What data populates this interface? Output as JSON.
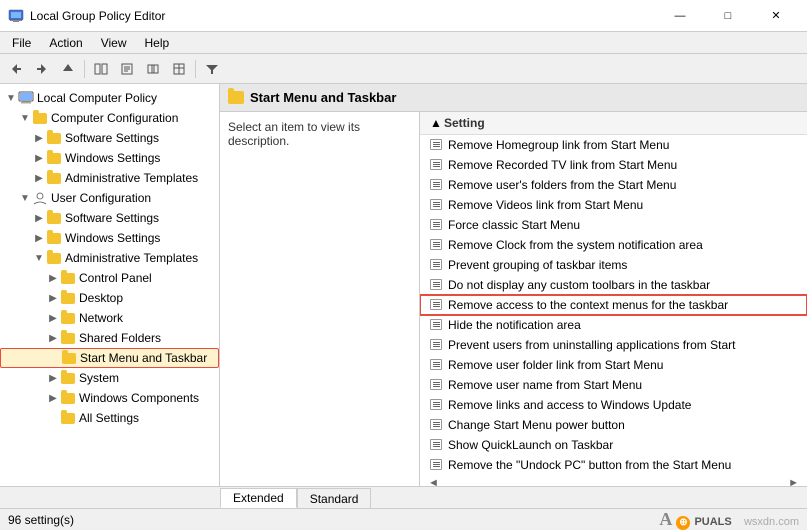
{
  "window": {
    "title": "Local Group Policy Editor",
    "controls": {
      "minimize": "—",
      "maximize": "□",
      "close": "✕"
    }
  },
  "menu": {
    "items": [
      "File",
      "Action",
      "View",
      "Help"
    ]
  },
  "toolbar": {
    "buttons": [
      "◀",
      "▶",
      "⬆",
      "📋",
      "📋",
      "🔗",
      "📋",
      "🔽"
    ]
  },
  "tree": {
    "root_label": "Local Computer Policy",
    "items": [
      {
        "id": "computer-config",
        "label": "Computer Configuration",
        "indent": 1,
        "type": "computer",
        "expanded": true
      },
      {
        "id": "software-settings-1",
        "label": "Software Settings",
        "indent": 2,
        "type": "folder"
      },
      {
        "id": "windows-settings-1",
        "label": "Windows Settings",
        "indent": 2,
        "type": "folder"
      },
      {
        "id": "admin-templates-1",
        "label": "Administrative Templates",
        "indent": 2,
        "type": "folder"
      },
      {
        "id": "user-config",
        "label": "User Configuration",
        "indent": 1,
        "type": "computer",
        "expanded": true
      },
      {
        "id": "software-settings-2",
        "label": "Software Settings",
        "indent": 2,
        "type": "folder"
      },
      {
        "id": "windows-settings-2",
        "label": "Windows Settings",
        "indent": 2,
        "type": "folder"
      },
      {
        "id": "admin-templates-2",
        "label": "Administrative Templates",
        "indent": 2,
        "type": "folder",
        "expanded": true
      },
      {
        "id": "control-panel",
        "label": "Control Panel",
        "indent": 3,
        "type": "folder"
      },
      {
        "id": "desktop",
        "label": "Desktop",
        "indent": 3,
        "type": "folder"
      },
      {
        "id": "network",
        "label": "Network",
        "indent": 3,
        "type": "folder"
      },
      {
        "id": "shared-folders",
        "label": "Shared Folders",
        "indent": 3,
        "type": "folder"
      },
      {
        "id": "start-menu-taskbar",
        "label": "Start Menu and Taskbar",
        "indent": 3,
        "type": "folder",
        "selected": true,
        "highlighted": true
      },
      {
        "id": "system",
        "label": "System",
        "indent": 3,
        "type": "folder"
      },
      {
        "id": "windows-components",
        "label": "Windows Components",
        "indent": 3,
        "type": "folder"
      },
      {
        "id": "all-settings",
        "label": "All Settings",
        "indent": 3,
        "type": "folder"
      }
    ]
  },
  "right_panel": {
    "header": "Start Menu and Taskbar",
    "description": "Select an item to view its description.",
    "column_header": "Setting",
    "settings": [
      {
        "id": "s1",
        "label": "Remove Homegroup link from Start Menu"
      },
      {
        "id": "s2",
        "label": "Remove Recorded TV link from Start Menu"
      },
      {
        "id": "s3",
        "label": "Remove user's folders from the Start Menu"
      },
      {
        "id": "s4",
        "label": "Remove Videos link from Start Menu"
      },
      {
        "id": "s5",
        "label": "Force classic Start Menu"
      },
      {
        "id": "s6",
        "label": "Remove Clock from the system notification area"
      },
      {
        "id": "s7",
        "label": "Prevent grouping of taskbar items"
      },
      {
        "id": "s8",
        "label": "Do not display any custom toolbars in the taskbar"
      },
      {
        "id": "s9",
        "label": "Remove access to the context menus for the taskbar",
        "highlighted": true
      },
      {
        "id": "s10",
        "label": "Hide the notification area"
      },
      {
        "id": "s11",
        "label": "Prevent users from uninstalling applications from Start"
      },
      {
        "id": "s12",
        "label": "Remove user folder link from Start Menu"
      },
      {
        "id": "s13",
        "label": "Remove user name from Start Menu"
      },
      {
        "id": "s14",
        "label": "Remove links and access to Windows Update"
      },
      {
        "id": "s15",
        "label": "Change Start Menu power button"
      },
      {
        "id": "s16",
        "label": "Show QuickLaunch on Taskbar"
      },
      {
        "id": "s17",
        "label": "Remove the \"Undock PC\" button from the Start Menu"
      }
    ]
  },
  "tabs": [
    {
      "id": "extended",
      "label": "Extended",
      "active": true
    },
    {
      "id": "standard",
      "label": "Standard",
      "active": false
    }
  ],
  "status_bar": {
    "count": "96 setting(s)"
  },
  "watermark": {
    "text": "A⊕PUALS",
    "domain": "wsxdn.com"
  }
}
